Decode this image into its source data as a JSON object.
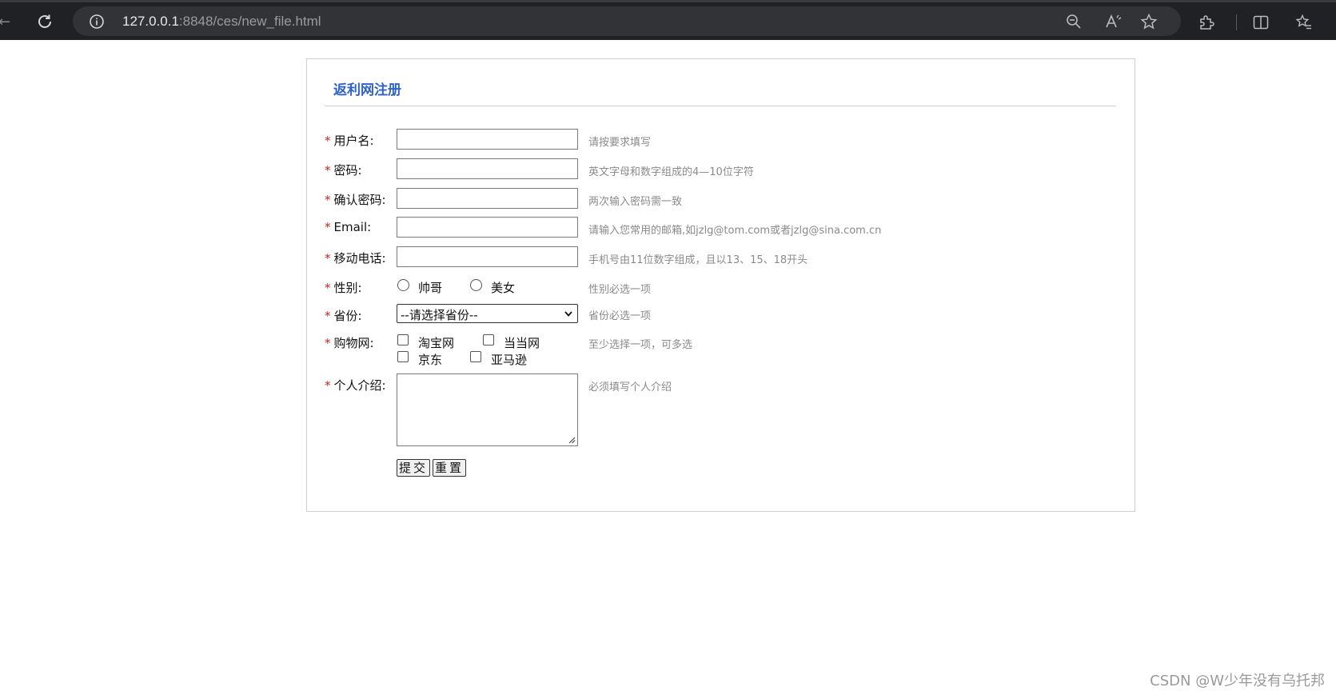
{
  "browser": {
    "url_host": "127.0.0.1",
    "url_path": ":8848/ces/new_file.html"
  },
  "form": {
    "title": "返利网注册",
    "required_mark": "*",
    "username": {
      "label": "用户名:",
      "hint": "请按要求填写",
      "value": ""
    },
    "password": {
      "label": "密码:",
      "hint": "英文字母和数字组成的4—10位字符",
      "value": ""
    },
    "confirm_password": {
      "label": "确认密码:",
      "hint": "两次输入密码需一致",
      "value": ""
    },
    "email": {
      "label": "Email:",
      "hint": "请输入您常用的邮箱,如jzlg@tom.com或者jzlg@sina.com.cn",
      "value": ""
    },
    "mobile": {
      "label": "移动电话:",
      "hint": "手机号由11位数字组成，且以13、15、18开头",
      "value": ""
    },
    "gender": {
      "label": "性别:",
      "options": [
        "帅哥",
        "美女"
      ],
      "hint": "性别必选一项"
    },
    "province": {
      "label": "省份:",
      "selected": "--请选择省份--",
      "hint": "省份必选一项"
    },
    "shopping": {
      "label": "购物网:",
      "options": [
        "淘宝网",
        "当当网",
        "京东",
        "亚马逊"
      ],
      "hint": "至少选择一项，可多选"
    },
    "intro": {
      "label": "个人介绍:",
      "hint": "必须填写个人介绍",
      "value": ""
    },
    "submit_label": "提交",
    "reset_label": "重置"
  },
  "watermark": "CSDN @W少年没有乌托邦"
}
